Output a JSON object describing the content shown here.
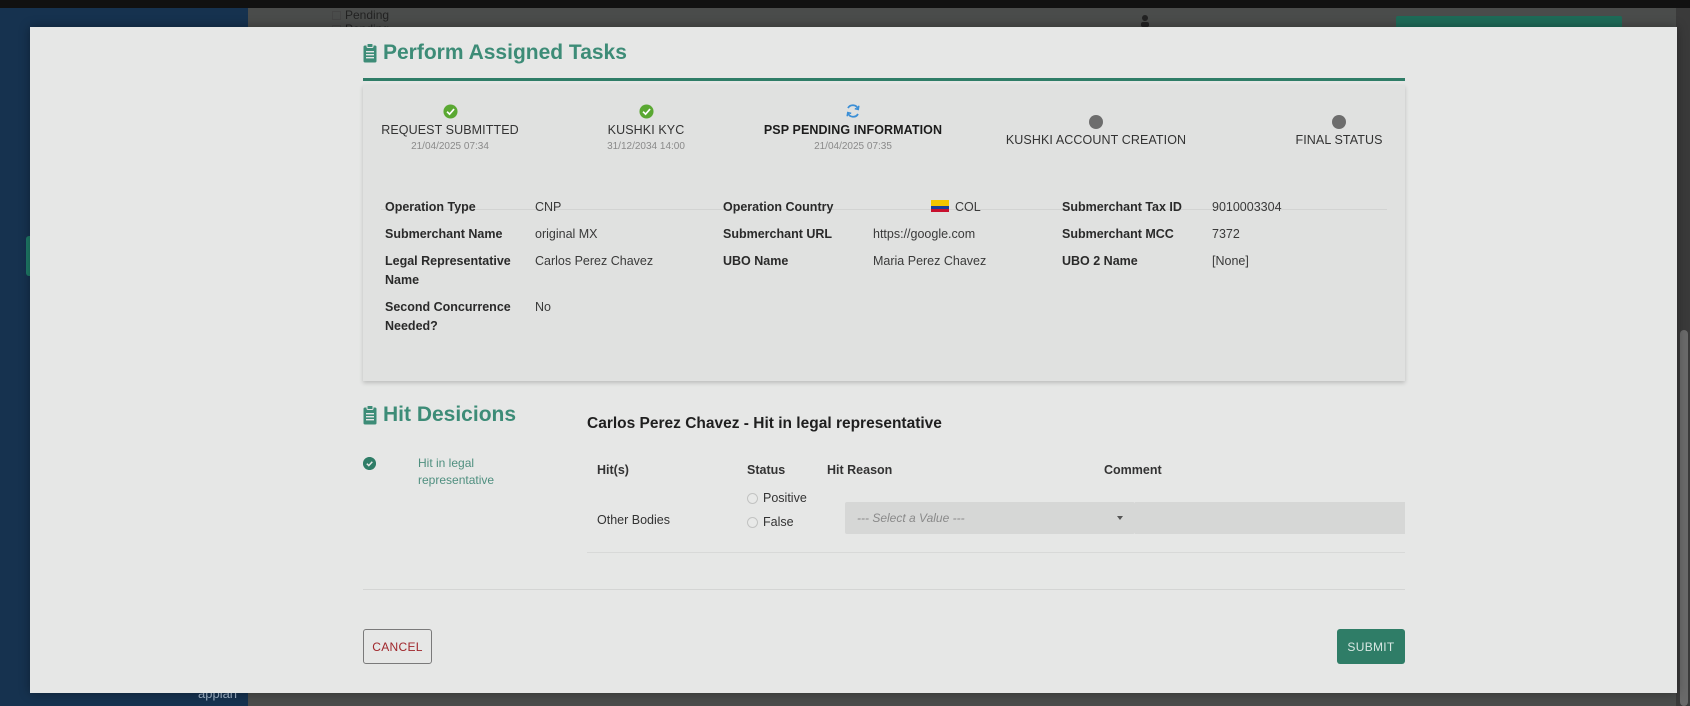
{
  "background": {
    "pending_items": [
      "Pending",
      "Pending"
    ],
    "footer_logo": "appian"
  },
  "modal": {
    "title": "Perform Assigned Tasks",
    "steps": [
      {
        "label": "REQUEST SUBMITTED",
        "date": "21/04/2025 07:34",
        "status": "done"
      },
      {
        "label": "KUSHKI KYC",
        "date": "31/12/2034 14:00",
        "status": "done"
      },
      {
        "label": "PSP PENDING INFORMATION",
        "date": "21/04/2025 07:35",
        "status": "in-progress"
      },
      {
        "label": "KUSHKI ACCOUNT CREATION",
        "date": "",
        "status": "pending"
      },
      {
        "label": "FINAL STATUS",
        "date": "",
        "status": "pending"
      }
    ],
    "fields": {
      "operation_type": {
        "label": "Operation Type",
        "value": "CNP"
      },
      "operation_country": {
        "label": "Operation Country",
        "value": "COL"
      },
      "submerchant_tax_id": {
        "label": "Submerchant Tax ID",
        "value": "9010003304"
      },
      "submerchant_name": {
        "label": "Submerchant Name",
        "value": "original MX"
      },
      "submerchant_url": {
        "label": "Submerchant URL",
        "value": "https://google.com"
      },
      "submerchant_mcc": {
        "label": "Submerchant MCC",
        "value": "7372"
      },
      "legal_representative_name": {
        "label": "Legal Representative Name",
        "value": "Carlos Perez Chavez"
      },
      "ubo_name": {
        "label": "UBO Name",
        "value": "Maria Perez Chavez"
      },
      "ubo_2_name": {
        "label": "UBO 2 Name",
        "value": "[None]"
      },
      "second_concurrence": {
        "label": "Second Concurrence Needed?",
        "value": "No"
      }
    },
    "hit_decisions": {
      "title": "Hit Desicions",
      "side_item": "Hit in legal representative",
      "subtitle": "Carlos Perez Chavez - Hit in legal representative",
      "columns": {
        "hits": "Hit(s)",
        "status": "Status",
        "hit_reason": "Hit Reason",
        "comment": "Comment"
      },
      "row": {
        "hit": "Other Bodies",
        "status_options": [
          "Positive",
          "False"
        ],
        "hit_reason_placeholder": "--- Select a Value ---",
        "comment": ""
      }
    },
    "buttons": {
      "cancel": "CANCEL",
      "submit": "SUBMIT"
    }
  },
  "colors": {
    "accent": "#3d8c77",
    "primary_button": "#2f7d67",
    "cancel_text": "#a0262b",
    "sidebar": "#16324f",
    "done_check": "#5aa832",
    "in_progress": "#3c8fd6"
  }
}
